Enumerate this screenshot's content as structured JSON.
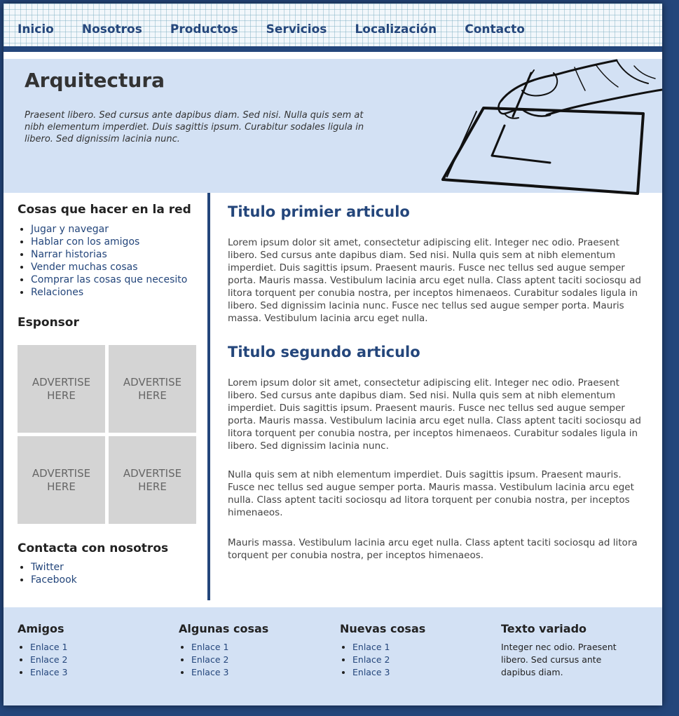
{
  "nav": {
    "items": [
      "Inicio",
      "Nosotros",
      "Productos",
      "Servicios",
      "Localización",
      "Contacto"
    ]
  },
  "header": {
    "title": "Arquitectura",
    "description": "Praesent libero. Sed cursus ante dapibus diam. Sed nisi. Nulla quis sem at nibh elementum imperdiet. Duis sagittis ipsum. Curabitur sodales ligula in libero. Sed dignissim lacinia nunc.",
    "illustration_icon": "hand-drawing-icon"
  },
  "sidebar": {
    "things_title": "Cosas que hacer en la red",
    "things_links": [
      "Jugar y navegar",
      "Hablar con los amigos",
      "Narrar historias",
      "Vender muchas cosas",
      "Comprar las cosas que necesito",
      "Relaciones"
    ],
    "sponsor_title": "Esponsor",
    "ads": [
      "ADVERTISE HERE",
      "ADVERTISE HERE",
      "ADVERTISE HERE",
      "ADVERTISE HERE"
    ],
    "contact_title": "Contacta con nosotros",
    "contact_links": [
      "Twitter",
      "Facebook"
    ]
  },
  "main": {
    "article1_title": "Titulo primier articulo",
    "article1_p1": "Lorem ipsum dolor sit amet, consectetur adipiscing elit. Integer nec odio. Praesent libero. Sed cursus ante dapibus diam. Sed nisi. Nulla quis sem at nibh elementum imperdiet. Duis sagittis ipsum. Praesent mauris. Fusce nec tellus sed augue semper porta. Mauris massa. Vestibulum lacinia arcu eget nulla. Class aptent taciti sociosqu ad litora torquent per conubia nostra, per inceptos himenaeos. Curabitur sodales ligula in libero. Sed dignissim lacinia nunc. Fusce nec tellus sed augue semper porta. Mauris massa. Vestibulum lacinia arcu eget nulla.",
    "article2_title": "Titulo segundo articulo",
    "article2_p1": "Lorem ipsum dolor sit amet, consectetur adipiscing elit. Integer nec odio. Praesent libero. Sed cursus ante dapibus diam. Sed nisi. Nulla quis sem at nibh elementum imperdiet. Duis sagittis ipsum. Praesent mauris. Fusce nec tellus sed augue semper porta. Mauris massa. Vestibulum lacinia arcu eget nulla. Class aptent taciti sociosqu ad litora torquent per conubia nostra, per inceptos himenaeos. Curabitur sodales ligula in libero. Sed dignissim lacinia nunc.",
    "article2_p2": "Nulla quis sem at nibh elementum imperdiet. Duis sagittis ipsum. Praesent mauris. Fusce nec tellus sed augue semper porta. Mauris massa. Vestibulum lacinia arcu eget nulla. Class aptent taciti sociosqu ad litora torquent per conubia nostra, per inceptos himenaeos.",
    "article2_p3": "Mauris massa. Vestibulum lacinia arcu eget nulla. Class aptent taciti sociosqu ad litora torquent per conubia nostra, per inceptos himenaeos."
  },
  "footer": {
    "col1": {
      "title": "Amigos",
      "links": [
        "Enlace 1",
        "Enlace 2",
        "Enlace 3"
      ]
    },
    "col2": {
      "title": "Algunas cosas",
      "links": [
        "Enlace 1",
        "Enlace 2",
        "Enlace 3"
      ]
    },
    "col3": {
      "title": "Nuevas cosas",
      "links": [
        "Enlace 1",
        "Enlace 2",
        "Enlace 3"
      ]
    },
    "col4": {
      "title": "Texto variado",
      "text": "Integer nec odio. Praesent libero. Sed cursus ante dapibus diam."
    }
  },
  "colors": {
    "brand": "#24467b",
    "header_bg": "#d3e1f4",
    "ad_bg": "#d4d4d4"
  }
}
